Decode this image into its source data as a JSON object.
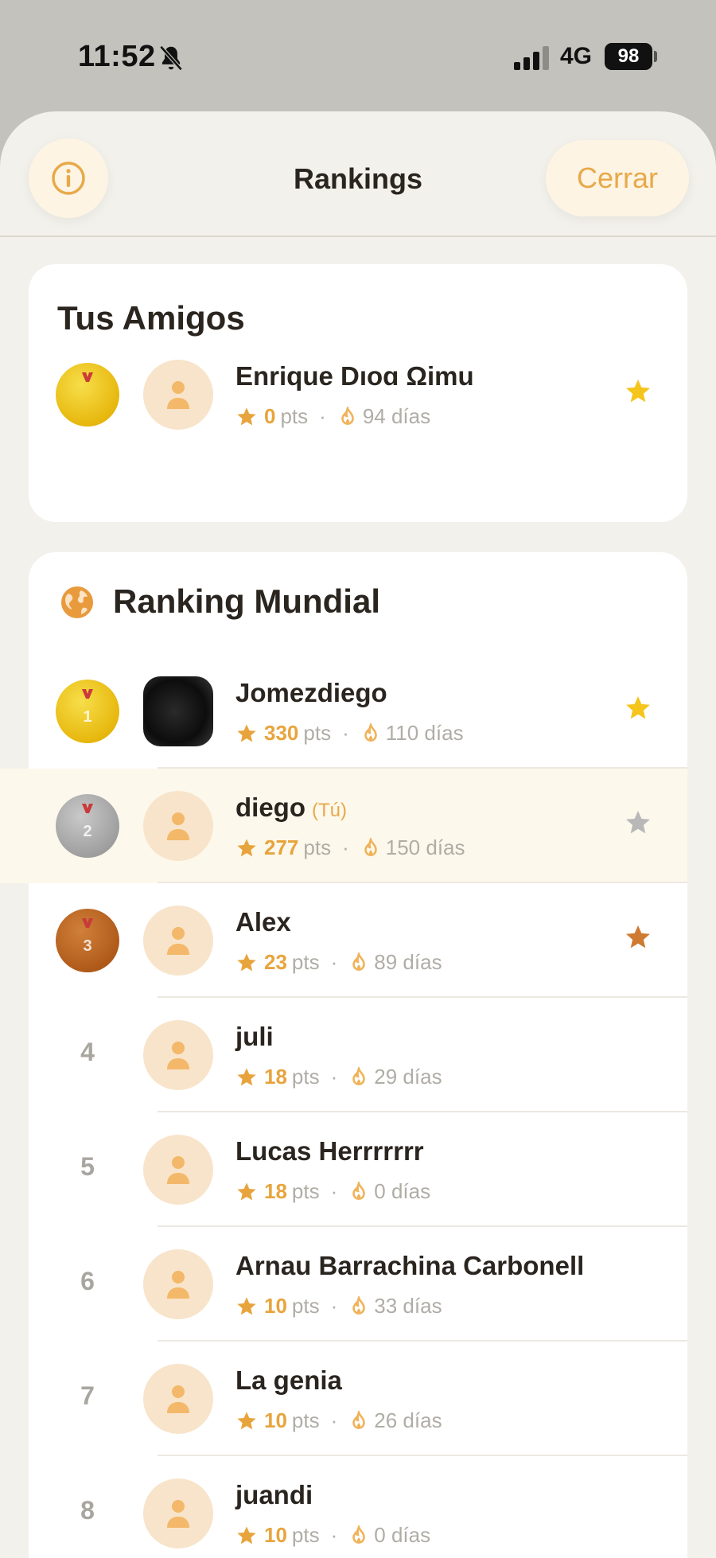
{
  "status_bar": {
    "time": "11:52",
    "network": "4G",
    "battery": "98"
  },
  "header": {
    "title": "Rankings",
    "close_label": "Cerrar"
  },
  "friends": {
    "title": "Tus Amigos",
    "rows": [
      {
        "medal": "gold",
        "name": "Enrique Dıoɑ Ωimu",
        "you_label": "",
        "points": "0",
        "days": "94 días",
        "star_color": "#f6c51b"
      }
    ]
  },
  "world": {
    "title": "Ranking Mundial",
    "rows": [
      {
        "rank": "1",
        "medal": "gold",
        "name": "Jomezdiego",
        "you_label": "",
        "points": "330",
        "days": "110 días",
        "star_color": "#f6c51b",
        "photo": true
      },
      {
        "rank": "2",
        "medal": "silver",
        "name": "diego",
        "you_label": "(Tú)",
        "points": "277",
        "days": "150 días",
        "star_color": "#b8b8b8",
        "highlight": true
      },
      {
        "rank": "3",
        "medal": "bronze",
        "name": "Alex",
        "you_label": "",
        "points": "23",
        "days": "89 días",
        "star_color": "#cf7a32"
      },
      {
        "rank": "4",
        "name": "juli",
        "you_label": "",
        "points": "18",
        "days": "29 días"
      },
      {
        "rank": "5",
        "name": "Lucas Herrrrrrr",
        "you_label": "",
        "points": "18",
        "days": "0 días"
      },
      {
        "rank": "6",
        "name": "Arnau Barrachina Carbonell",
        "you_label": "",
        "points": "10",
        "days": "33 días"
      },
      {
        "rank": "7",
        "name": "La genia",
        "you_label": "",
        "points": "10",
        "days": "26 días"
      },
      {
        "rank": "8",
        "name": "juandi",
        "you_label": "",
        "points": "10",
        "days": "0 días"
      }
    ]
  },
  "labels": {
    "pts": "pts",
    "separator": "·"
  },
  "colors": {
    "accent": "#e8a94a",
    "points": "#e8a43c",
    "gold": "#f6c51b",
    "silver": "#b8b8b8",
    "bronze": "#cf7a32"
  },
  "icons": {
    "info": "info-icon",
    "globe": "globe-icon",
    "star": "star-icon",
    "flame": "flame-icon",
    "medal": "medal-icon",
    "avatar": "user-icon"
  }
}
